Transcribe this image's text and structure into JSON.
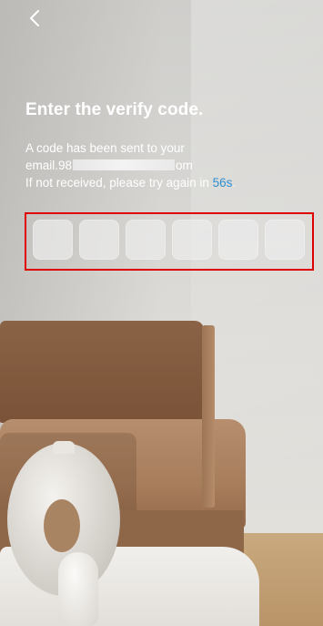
{
  "header": {
    "back_icon": "chevron-left-icon"
  },
  "verify": {
    "title": "Enter the verify code.",
    "sent_prefix": "A code has been sent to your",
    "email_start": "email.98",
    "email_end": "om",
    "retry_prefix": "If not received, please try again in ",
    "countdown": "56s",
    "retry_suffix": "."
  },
  "code_inputs": [
    "",
    "",
    "",
    "",
    "",
    ""
  ],
  "colors": {
    "countdown": "#2f8fd0",
    "highlight_frame": "#e00000"
  }
}
